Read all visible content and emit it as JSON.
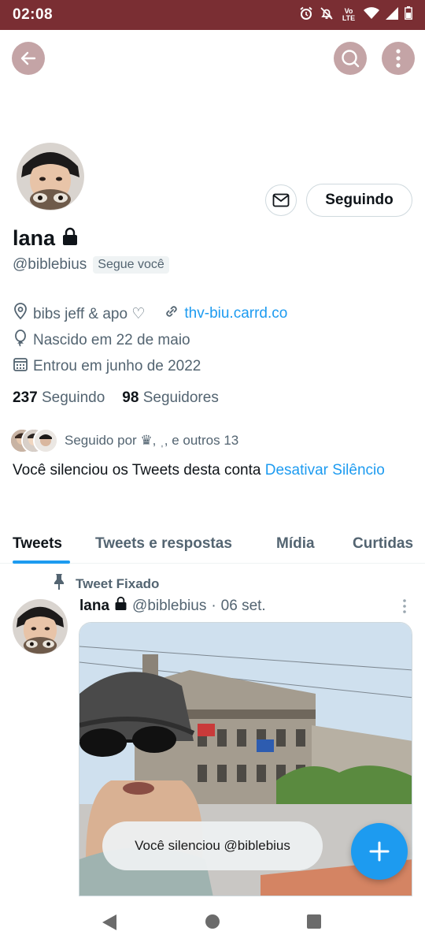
{
  "status_bar": {
    "time": "02:08",
    "network_label": "Vo LTE"
  },
  "profile": {
    "name": "lana",
    "handle": "@biblebius",
    "follows_you": "Segue você",
    "follow_button": "Seguindo",
    "location": "bibs jeff & apo ♡",
    "website": "thv-biu.carrd.co",
    "birthday": "Nascido em 22 de maio",
    "joined": "Entrou em junho de 2022",
    "following_count": "237",
    "following_label": "Seguindo",
    "followers_count": "98",
    "followers_label": "Seguidores",
    "followed_by": "Seguido por ♛, ˌ, e outros 13",
    "muted_notice": "Você silenciou os Tweets desta conta",
    "unmute_link": "Desativar Silêncio"
  },
  "tabs": [
    "Tweets",
    "Tweets e respostas",
    "Mídia",
    "Curtidas"
  ],
  "tweet": {
    "pinned_label": "Tweet Fixado",
    "name": "lana",
    "handle": "@biblebius",
    "separator": "·",
    "date": "06 set."
  },
  "toast": "Você silenciou @biblebius",
  "colors": {
    "status_bar": "#7a2e33",
    "accent": "#1d9bf0",
    "secondary_text": "#536471"
  },
  "icons": [
    "alarm-icon",
    "notifications-off-icon",
    "wifi-icon",
    "signal-icon",
    "battery-icon",
    "back-arrow-icon",
    "search-icon",
    "more-vertical-icon",
    "mail-icon",
    "lock-icon",
    "location-pin-icon",
    "link-icon",
    "balloon-icon",
    "calendar-icon",
    "pin-icon",
    "plus-icon",
    "nav-back-icon",
    "nav-home-icon",
    "nav-recents-icon"
  ]
}
